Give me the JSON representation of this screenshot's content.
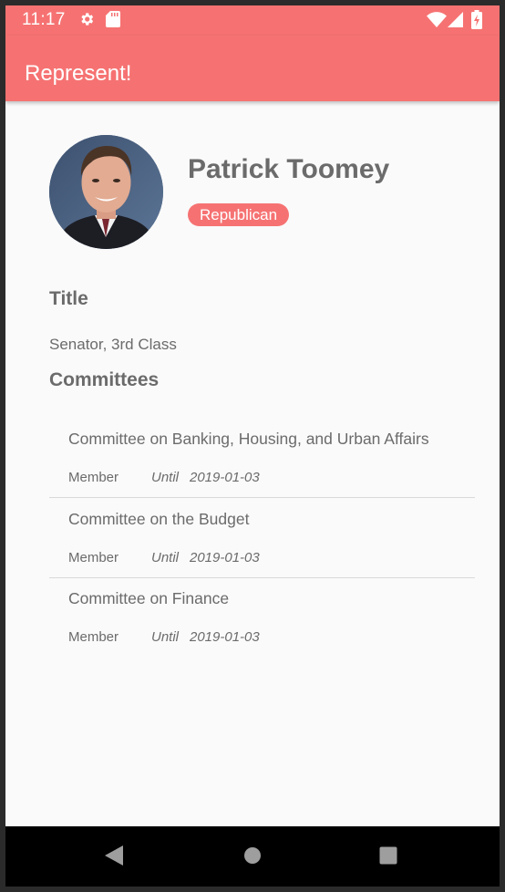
{
  "status_bar": {
    "time": "11:17",
    "icons": [
      "settings-icon",
      "sd-card-icon",
      "wifi-icon",
      "signal-icon",
      "battery-charging-icon"
    ]
  },
  "app_bar": {
    "title": "Represent!"
  },
  "profile": {
    "name": "Patrick Toomey",
    "party": "Republican",
    "party_color": "#f67272"
  },
  "title_section": {
    "heading": "Title",
    "value": "Senator, 3rd Class"
  },
  "committees_section": {
    "heading": "Committees",
    "items": [
      {
        "name": "Committee on Banking, Housing, and Urban Affairs",
        "role": "Member",
        "until_label": "Until",
        "until_date": "2019-01-03"
      },
      {
        "name": "Committee on the Budget",
        "role": "Member",
        "until_label": "Until",
        "until_date": "2019-01-03"
      },
      {
        "name": "Committee on Finance",
        "role": "Member",
        "until_label": "Until",
        "until_date": "2019-01-03"
      }
    ]
  },
  "nav_bar": {
    "icons": [
      "back-icon",
      "home-icon",
      "recents-icon"
    ]
  },
  "colors": {
    "accent": "#f67272",
    "text": "#6b6b6b",
    "background": "#fafafa"
  }
}
